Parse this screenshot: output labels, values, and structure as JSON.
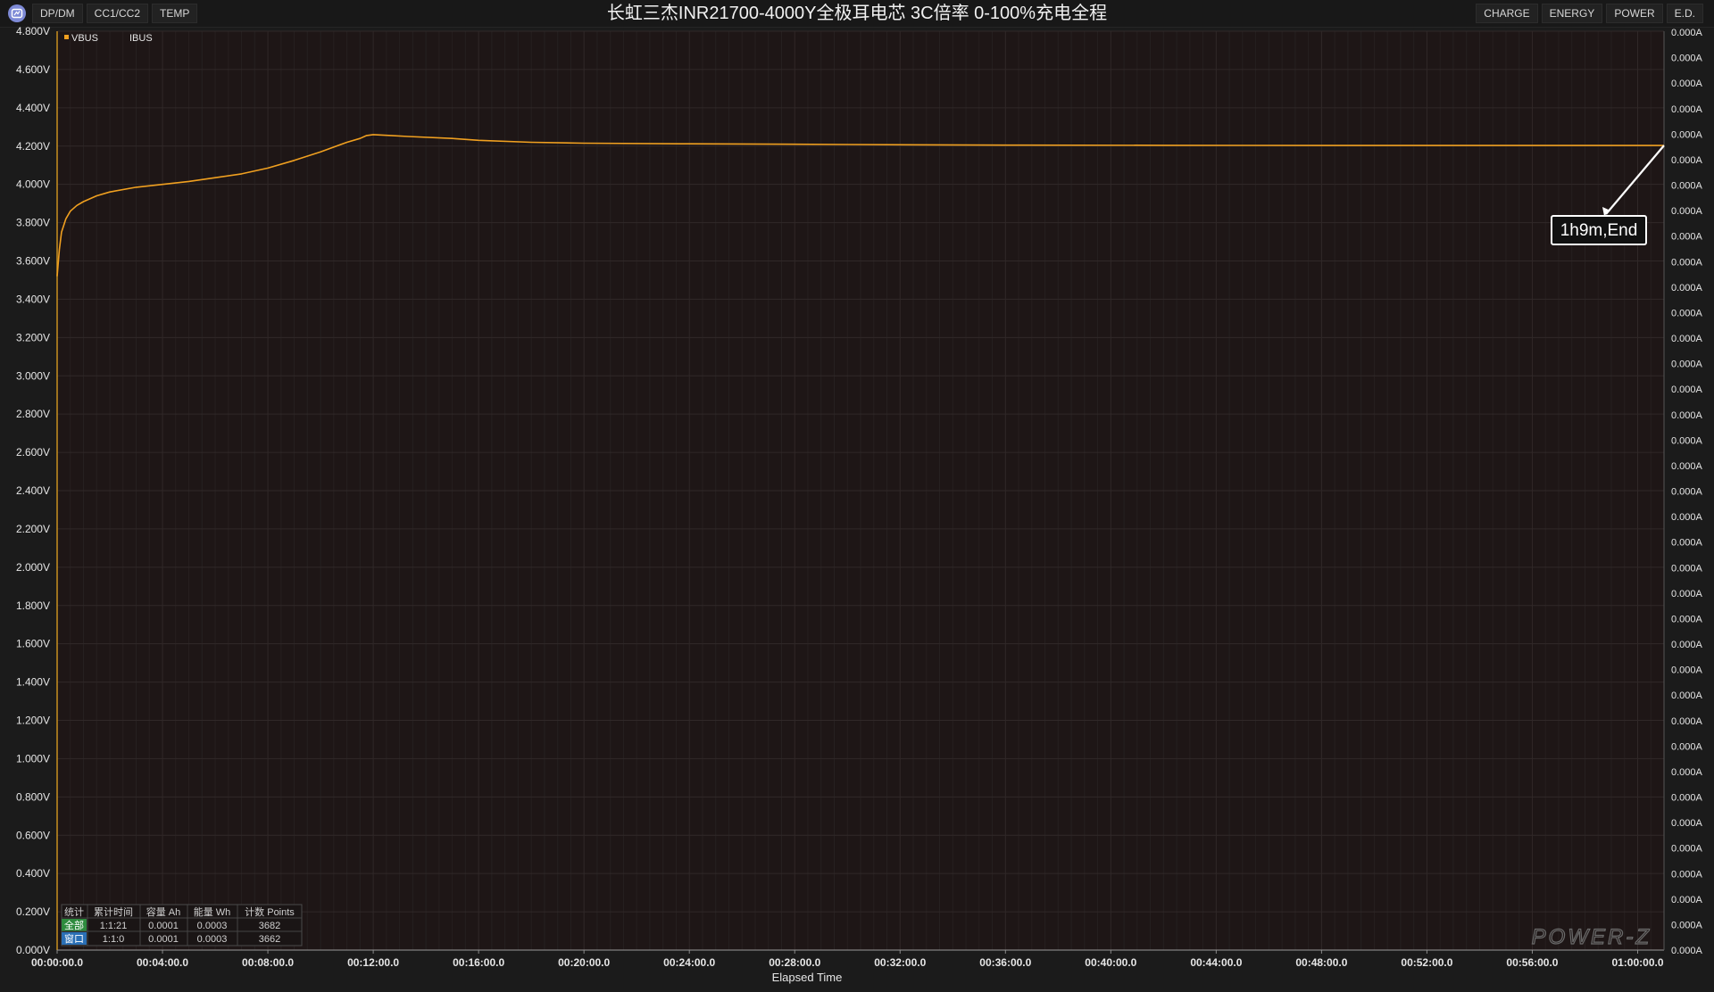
{
  "window": {
    "title": "长虹三杰INR21700-4000Y全极耳电芯 3C倍率 0-100%充电全程",
    "tabs_left": [
      "DP/DM",
      "CC1/CC2",
      "TEMP"
    ],
    "tabs_right": [
      "CHARGE",
      "ENERGY",
      "POWER",
      "E.D."
    ]
  },
  "chart_data": {
    "type": "line",
    "title": "长虹三杰INR21700-4000Y全极耳电芯 3C倍率 0-100%充电全程",
    "xlabel": "Elapsed Time",
    "ylabel": "",
    "x_unit": "seconds",
    "xlim": [
      0,
      3660
    ],
    "ylim": [
      0,
      4.8
    ],
    "y2lim": [
      0,
      0
    ],
    "grid": true,
    "legend_position": "top-left",
    "x_ticks": [
      "00:00:00.0",
      "00:04:00.0",
      "00:08:00.0",
      "00:12:00.0",
      "00:16:00.0",
      "00:20:00.0",
      "00:24:00.0",
      "00:28:00.0",
      "00:32:00.0",
      "00:36:00.0",
      "00:40:00.0",
      "00:44:00.0",
      "00:48:00.0",
      "00:52:00.0",
      "00:56:00.0",
      "01:00:00.0"
    ],
    "x_tick_values": [
      0,
      240,
      480,
      720,
      960,
      1200,
      1440,
      1680,
      1920,
      2160,
      2400,
      2640,
      2880,
      3120,
      3360,
      3600
    ],
    "y_ticks_left": [
      "0.000V",
      "0.200V",
      "0.400V",
      "0.600V",
      "0.800V",
      "1.000V",
      "1.200V",
      "1.400V",
      "1.600V",
      "1.800V",
      "2.000V",
      "2.200V",
      "2.400V",
      "2.600V",
      "2.800V",
      "3.000V",
      "3.200V",
      "3.400V",
      "3.600V",
      "3.800V",
      "4.000V",
      "4.200V",
      "4.400V",
      "4.600V",
      "4.800V"
    ],
    "y_tick_values_left": [
      0,
      0.2,
      0.4,
      0.6,
      0.8,
      1.0,
      1.2,
      1.4,
      1.6,
      1.8,
      2.0,
      2.2,
      2.4,
      2.6,
      2.8,
      3.0,
      3.2,
      3.4,
      3.6,
      3.8,
      4.0,
      4.2,
      4.4,
      4.6,
      4.8
    ],
    "y_tick_right_label": "0.000A",
    "y_tick_right_count": 37,
    "series": [
      {
        "name": "VBUS",
        "color": "#f0a020",
        "x": [
          0,
          5,
          10,
          20,
          30,
          45,
          60,
          90,
          120,
          180,
          240,
          300,
          360,
          420,
          480,
          540,
          600,
          660,
          690,
          705,
          720,
          760,
          800,
          900,
          960,
          1080,
          1200,
          1440,
          1800,
          2160,
          2520,
          2880,
          3240,
          3660
        ],
        "values": [
          3.52,
          3.66,
          3.75,
          3.82,
          3.86,
          3.89,
          3.91,
          3.94,
          3.96,
          3.985,
          4.0,
          4.015,
          4.035,
          4.055,
          4.085,
          4.125,
          4.17,
          4.22,
          4.24,
          4.255,
          4.26,
          4.255,
          4.25,
          4.24,
          4.23,
          4.22,
          4.215,
          4.212,
          4.208,
          4.205,
          4.204,
          4.203,
          4.203,
          4.203
        ]
      },
      {
        "name": "IBUS",
        "color": "#d0d0d0",
        "x": [],
        "values": []
      }
    ],
    "annotations": [
      {
        "text": "1h9m,End",
        "x": 3660,
        "y": 4.203
      }
    ],
    "stats_table": {
      "headers": [
        "统计",
        "累计时间",
        "容量 Ah",
        "能量 Wh",
        "计数 Points"
      ],
      "rows": [
        {
          "label": "全部",
          "label_color": "#2e8b3e",
          "cells": [
            "1:1:21",
            "0.0001",
            "0.0003",
            "3682"
          ]
        },
        {
          "label": "窗口",
          "label_color": "#2a6fb5",
          "cells": [
            "1:1:0",
            "0.0001",
            "0.0003",
            "3662"
          ]
        }
      ]
    },
    "watermark": "POWER-Z"
  }
}
